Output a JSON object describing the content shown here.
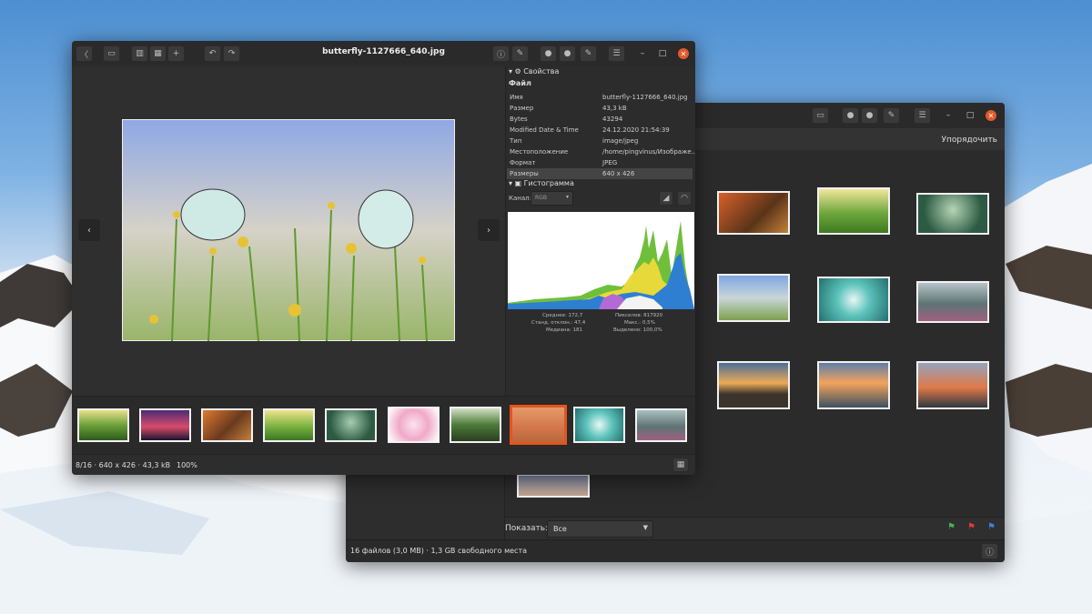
{
  "viewer": {
    "title": "butterfly-1127666_640.jpg",
    "status": {
      "index": "8/16",
      "dims": "640 x 426",
      "size": "43,3 kB",
      "zoom": "100%"
    },
    "thumbnails": [
      "forest-sunrise",
      "red-tree",
      "autumn-road",
      "green-meadow",
      "foggy-forest",
      "cherry-blossom",
      "forest-path",
      "orange-flowers",
      "frost-leaves",
      "misty-hills"
    ],
    "selected_thumbnail": 7
  },
  "properties": {
    "header": "Свойства",
    "file_section": "Файл",
    "rows": [
      {
        "k": "Имя",
        "v": "butterfly-1127666_640.jpg"
      },
      {
        "k": "Размер",
        "v": "43,3 kB"
      },
      {
        "k": "Bytes",
        "v": "43294"
      },
      {
        "k": "Modified Date & Time",
        "v": "24.12.2020 21:54:39"
      },
      {
        "k": "Тип",
        "v": "image/jpeg"
      },
      {
        "k": "Местоположение",
        "v": "/home/pingvinus/Изображе..."
      },
      {
        "k": "Формат",
        "v": "JPEG"
      },
      {
        "k": "Размеры",
        "v": "640 x 426"
      }
    ],
    "selected_row": 7
  },
  "histogram": {
    "header": "Гистограмма",
    "channel_label": "Канал:",
    "channel_value": "RGB",
    "stats": {
      "mean_label": "Среднее:",
      "mean": "172,7",
      "std_label": "Станд. отклон.:",
      "std": "47,4",
      "median_label": "Медиана:",
      "median": "181",
      "pixels_label": "Пикселов:",
      "pixels": "817920",
      "count_label": "Макс.:",
      "count": "0,5%",
      "percent_label": "Выделено:",
      "percent": "100,0%"
    }
  },
  "browser": {
    "sort_label": "Упорядочить",
    "show_label": "Показать:",
    "show_value": "Все",
    "status": "16 файлов (3,0 MB)  ·  1,3 GB свободного места",
    "grid": [
      "autumn-forest",
      "sunny-meadow",
      "green-forest",
      "butterflies",
      "dandelion",
      "mountain-valley",
      "sunset-clouds",
      "sea-sunset",
      "pier-sunset",
      "misty-lake"
    ]
  }
}
